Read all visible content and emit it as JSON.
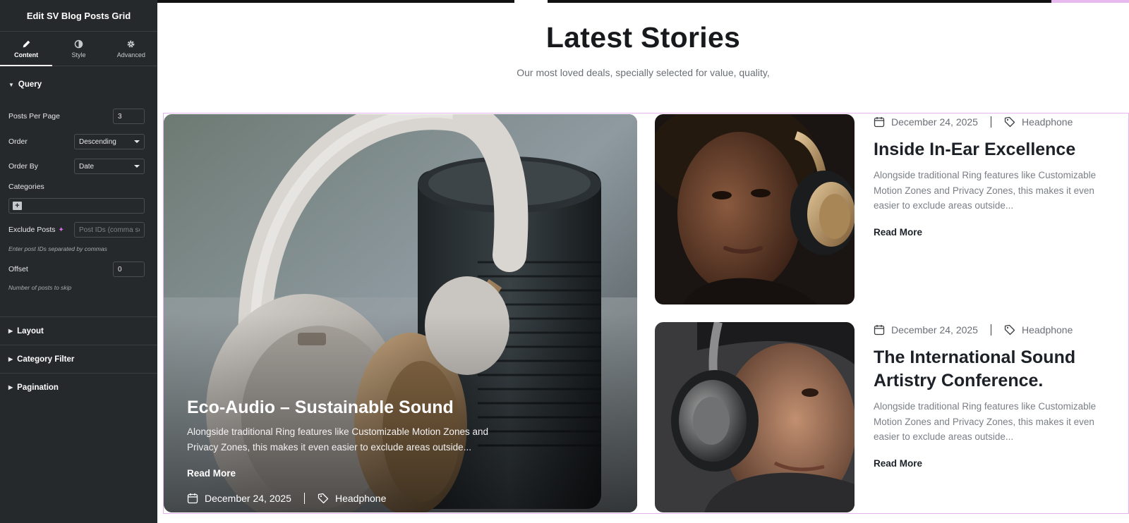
{
  "panel": {
    "title": "Edit SV Blog Posts Grid",
    "tabs": [
      {
        "label": "Content",
        "icon": "pencil-icon"
      },
      {
        "label": "Style",
        "icon": "half-circle-icon"
      },
      {
        "label": "Advanced",
        "icon": "gear-icon"
      }
    ],
    "query": {
      "section_label": "Query",
      "posts_per_page_label": "Posts Per Page",
      "posts_per_page_value": "3",
      "order_label": "Order",
      "order_value": "Descending",
      "order_by_label": "Order By",
      "order_by_value": "Date",
      "categories_label": "Categories",
      "exclude_posts_label": "Exclude Posts",
      "exclude_posts_placeholder": "Post IDs (comma se",
      "exclude_help": "Enter post IDs separated by commas",
      "offset_label": "Offset",
      "offset_value": "0",
      "offset_help": "Number of posts to skip"
    },
    "sections": [
      "Layout",
      "Category Filter",
      "Pagination"
    ]
  },
  "preview": {
    "heading": "Latest Stories",
    "subheading": "Our most loved deals, specially selected for value, quality,",
    "featured": {
      "date": "December 24, 2025",
      "category": "Headphone",
      "title": "Eco-Audio – Sustainable Sound",
      "excerpt": "Alongside traditional Ring features like Customizable Motion Zones and Privacy Zones, this makes it even easier to exclude areas outside...",
      "read_more": "Read More"
    },
    "posts": [
      {
        "date": "December 24, 2025",
        "category": "Headphone",
        "title": "Inside In-Ear Excellence",
        "excerpt": "Alongside traditional Ring features like Customizable Motion Zones and Privacy Zones, this makes it even easier to exclude areas outside...",
        "read_more": "Read More"
      },
      {
        "date": "December 24, 2025",
        "category": "Headphone",
        "title": "The International Sound Artistry Conference.",
        "excerpt": "Alongside traditional Ring features like Customizable Motion Zones and Privacy Zones, this makes it even easier to exclude areas outside...",
        "read_more": "Read More"
      }
    ]
  },
  "colors": {
    "panel_bg": "#26292c",
    "accent_outline": "#e7b3ee",
    "heading": "#17191c"
  }
}
